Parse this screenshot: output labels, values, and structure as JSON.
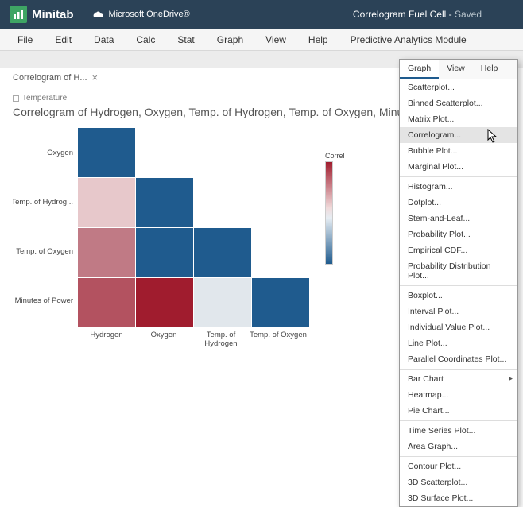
{
  "titlebar": {
    "app": "Minitab",
    "storage": "Microsoft OneDrive®",
    "doc": "Correlogram Fuel Cell",
    "status": "Saved"
  },
  "menu": [
    "File",
    "Edit",
    "Data",
    "Calc",
    "Stat",
    "Graph",
    "View",
    "Help",
    "Predictive Analytics Module"
  ],
  "tab": {
    "label": "Correlogram of H...",
    "crumb": "Temperature"
  },
  "chart_data": {
    "type": "heatmap",
    "title": "Correlogram of Hydrogen, Oxygen, Temp. of Hydrogen, Temp. of Oxygen, Minutes of P",
    "legend_label": "Correl",
    "y_categories": [
      "Oxygen",
      "Temp. of Hydrog...",
      "Temp. of Oxygen",
      "Minutes of Power"
    ],
    "x_categories": [
      "Hydrogen",
      "Oxygen",
      "Temp. of Hydrogen",
      "Temp. of Oxygen"
    ],
    "colors": [
      [
        "#1f5b8e",
        null,
        null,
        null
      ],
      [
        "#e7c8cb",
        "#1f5b8e",
        null,
        null
      ],
      [
        "#c07a85",
        "#1f5b8e",
        "#1f5b8e",
        null
      ],
      [
        "#b35260",
        "#a01c2e",
        "#e1e7ec",
        "#1f5b8e"
      ]
    ],
    "value_range": [
      -1,
      1
    ]
  },
  "popup": {
    "tabs": [
      "Graph",
      "View",
      "Help"
    ],
    "active_tab": 0,
    "highlighted": 3,
    "groups": [
      [
        "Scatterplot...",
        "Binned Scatterplot...",
        "Matrix Plot...",
        "Correlogram...",
        "Bubble Plot...",
        "Marginal Plot..."
      ],
      [
        "Histogram...",
        "Dotplot...",
        "Stem-and-Leaf...",
        "Probability Plot...",
        "Empirical CDF...",
        "Probability Distribution Plot..."
      ],
      [
        "Boxplot...",
        "Interval Plot...",
        "Individual Value Plot...",
        "Line Plot...",
        "Parallel Coordinates Plot..."
      ],
      [
        "Bar Chart",
        "Heatmap...",
        "Pie Chart..."
      ],
      [
        "Time Series Plot...",
        "Area Graph..."
      ],
      [
        "Contour Plot...",
        "3D Scatterplot...",
        "3D Surface Plot..."
      ]
    ],
    "submenu_items": [
      "Bar Chart"
    ]
  }
}
